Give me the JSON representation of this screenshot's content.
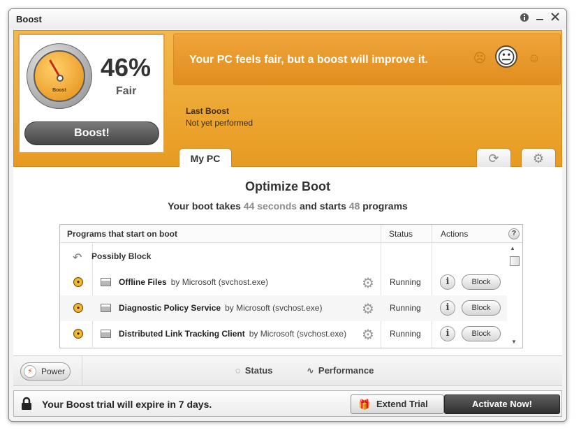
{
  "window": {
    "title": "Boost"
  },
  "titlebar": {
    "info_icon": "info-icon",
    "minimize_icon": "minimize-icon",
    "close_icon": "close-icon"
  },
  "score": {
    "percent": "46%",
    "rating": "Fair",
    "gauge_label": "Boost",
    "boost_button": "Boost!"
  },
  "message": {
    "text": "Your PC feels fair, but a boost will improve it.",
    "faces": [
      "sad-face-icon",
      "neutral-face-icon",
      "happy-face-icon"
    ],
    "active_face": "neutral"
  },
  "last_boost": {
    "label": "Last Boost",
    "value": "Not yet performed"
  },
  "tabs": {
    "mypc": "My PC",
    "refresh_icon": "refresh-icon",
    "settings_icon": "settings-icon"
  },
  "optimize": {
    "title": "Optimize Boot",
    "sub_prefix": "Your boot takes",
    "seconds": "44 seconds",
    "sub_middle": "and starts",
    "programs_count": "48",
    "sub_suffix": "programs"
  },
  "table": {
    "headers": {
      "programs": "Programs that start on boot",
      "status": "Status",
      "actions": "Actions",
      "help": "?"
    },
    "group": "Possibly Block",
    "rows": [
      {
        "name": "Offline Files",
        "by": "by Microsoft (svchost.exe)",
        "status": "Running",
        "info": "i",
        "action": "Block"
      },
      {
        "name": "Diagnostic Policy Service",
        "by": "by Microsoft (svchost.exe)",
        "status": "Running",
        "info": "i",
        "action": "Block"
      },
      {
        "name": "Distributed Link Tracking Client",
        "by": "by Microsoft (svchost.exe)",
        "status": "Running",
        "info": "i",
        "action": "Block"
      }
    ]
  },
  "footer": {
    "power": "Power",
    "status": "Status",
    "performance": "Performance"
  },
  "trial": {
    "text": "Your Boost trial will expire in 7 days.",
    "extend": "Extend Trial",
    "activate": "Activate Now!"
  },
  "colors": {
    "accent_orange": "#e79a21",
    "dark_button": "#454545"
  }
}
